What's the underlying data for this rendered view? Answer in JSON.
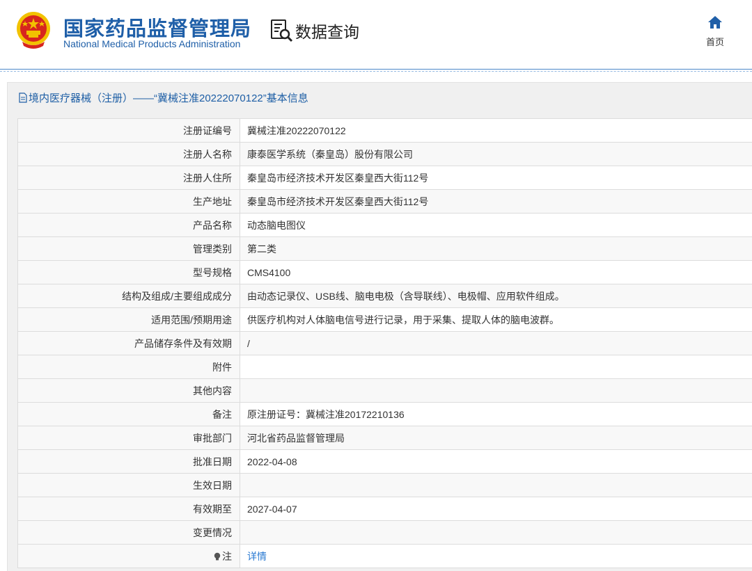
{
  "header": {
    "brand_cn": "国家药品监督管理局",
    "brand_en": "National Medical Products Administration",
    "data_query": "数据查询",
    "home_label": "首页"
  },
  "panel": {
    "title": "境内医疗器械（注册）——“冀械注准20222070122”基本信息"
  },
  "rows": [
    {
      "label": "注册证编号",
      "value": "冀械注准20222070122"
    },
    {
      "label": "注册人名称",
      "value": "康泰医学系统（秦皇岛）股份有限公司"
    },
    {
      "label": "注册人住所",
      "value": "秦皇岛市经济技术开发区秦皇西大街112号"
    },
    {
      "label": "生产地址",
      "value": "秦皇岛市经济技术开发区秦皇西大街112号"
    },
    {
      "label": "产品名称",
      "value": "动态脑电图仪"
    },
    {
      "label": "管理类别",
      "value": "第二类"
    },
    {
      "label": "型号规格",
      "value": "CMS4100"
    },
    {
      "label": "结构及组成/主要组成成分",
      "value": "由动态记录仪、USB线、脑电电极（含导联线）、电极帽、应用软件组成。"
    },
    {
      "label": "适用范围/预期用途",
      "value": "供医疗机构对人体脑电信号进行记录，用于采集、提取人体的脑电波群。"
    },
    {
      "label": "产品储存条件及有效期",
      "value": "/"
    },
    {
      "label": "附件",
      "value": ""
    },
    {
      "label": "其他内容",
      "value": ""
    },
    {
      "label": "备注",
      "value": "原注册证号：冀械注准20172210136"
    },
    {
      "label": "审批部门",
      "value": "河北省药品监督管理局"
    },
    {
      "label": "批准日期",
      "value": "2022-04-08"
    },
    {
      "label": "生效日期",
      "value": ""
    },
    {
      "label": "有效期至",
      "value": "2027-04-07"
    },
    {
      "label": "变更情况",
      "value": ""
    },
    {
      "label": "注",
      "value": "详情"
    }
  ],
  "colors": {
    "brand_blue": "#1f5fa8",
    "link_blue": "#2a7ad2",
    "emblem_red": "#d7261e",
    "emblem_gold": "#f2c200"
  },
  "icons": {
    "emblem": "national-emblem-icon",
    "data_query": "search-document-icon",
    "home": "home-icon",
    "doc": "document-icon",
    "note": "lightbulb-icon"
  }
}
